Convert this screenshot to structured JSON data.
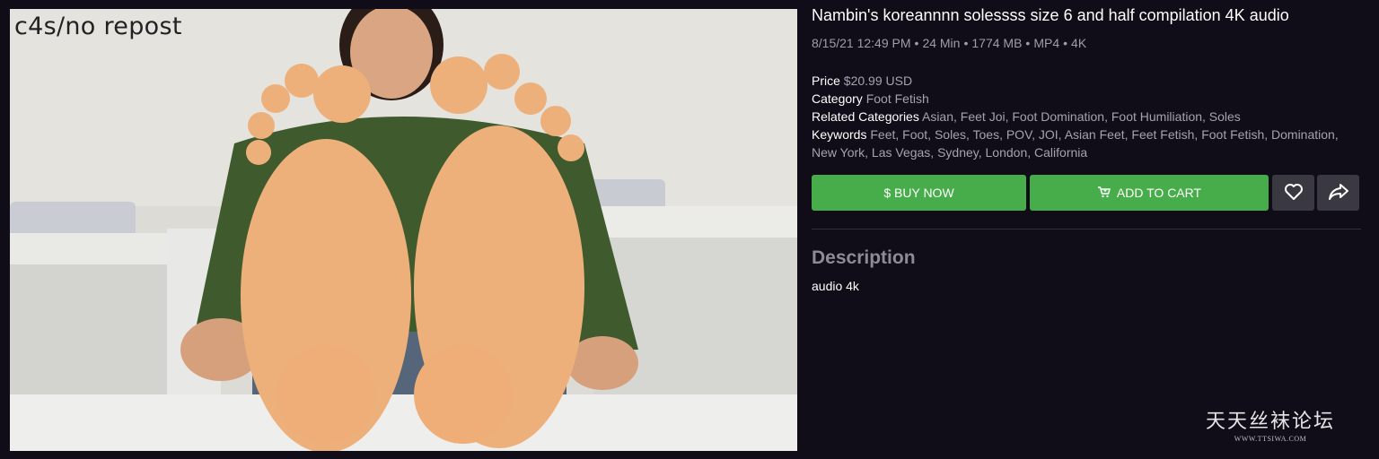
{
  "preview": {
    "overlay_text": "c4s/no repost"
  },
  "product": {
    "title": "Nambin's koreannnn solessss size 6 and half compilation 4K audio",
    "meta": {
      "date": "8/15/21 12:49 PM",
      "duration": "24 Min",
      "size": "1774 MB",
      "format": "MP4",
      "resolution": "4K",
      "separator": "•"
    },
    "price_label": "Price",
    "price_value": "$20.99 USD",
    "category_label": "Category",
    "category_value": "Foot Fetish",
    "related_label": "Related Categories",
    "related_value": "Asian, Feet Joi, Foot Domination, Foot Humiliation, Soles",
    "keywords_label": "Keywords",
    "keywords_value": "Feet, Foot, Soles, Toes, POV, JOI, Asian Feet, Feet Fetish, Foot Fetish, Domination, New York, Las Vegas, Sydney, London, California"
  },
  "actions": {
    "buy_label": "$ BUY NOW",
    "cart_label": "ADD TO CART",
    "cart_icon": "cart-icon",
    "favorite_icon": "heart-icon",
    "share_icon": "share-icon"
  },
  "description": {
    "heading": "Description",
    "text": "audio 4k"
  },
  "site_watermark": {
    "name": "天天丝袜论坛",
    "url": "WWW.TTSIWA.COM"
  },
  "colors": {
    "background": "#100d18",
    "accent_green": "#46ad4a",
    "muted_text": "#a5a2ae",
    "icon_button": "#3a3840"
  }
}
